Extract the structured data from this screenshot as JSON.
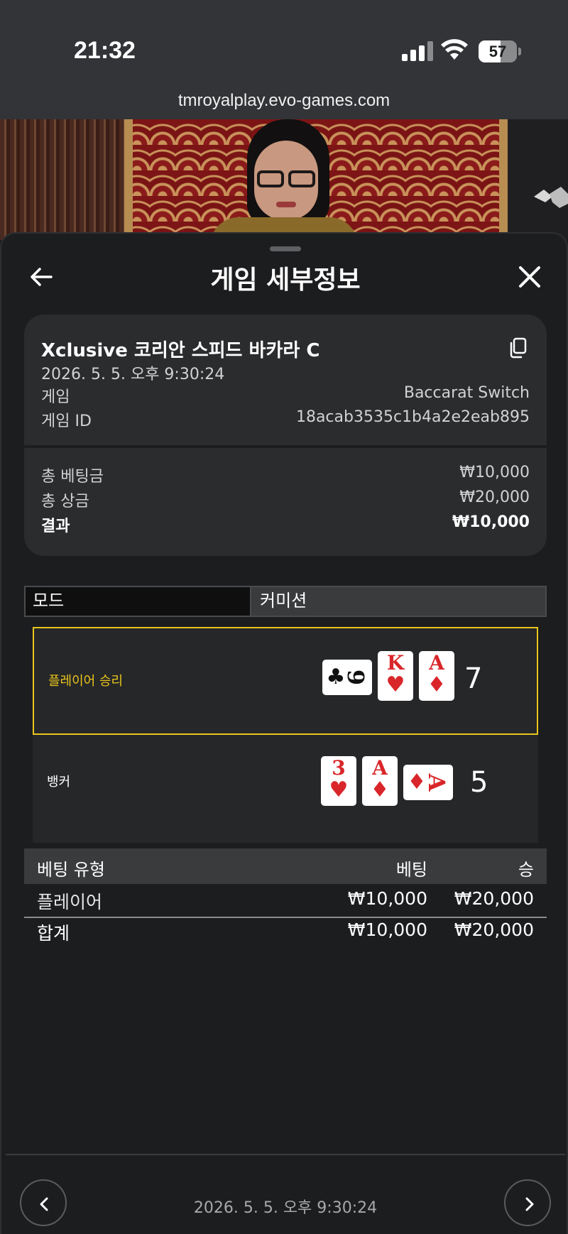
{
  "status_bar": {
    "time": "21:32",
    "battery": "57",
    "battery_level": 0.57
  },
  "browser": {
    "url": "tmroyalplay.evo-games.com"
  },
  "sheet": {
    "title": "게임 세부정보"
  },
  "game_info": {
    "table_name": "Xclusive 코리안 스피드 바카라 C",
    "datetime": "2026. 5. 5. 오후 9:30:24",
    "game_label": "게임",
    "game_value": "Baccarat Switch",
    "game_id_label": "게임 ID",
    "game_id_value": "18acab3535c1b4a2e2eab895"
  },
  "totals": {
    "total_bet_label": "총 베팅금",
    "total_bet_value": "₩10,000",
    "total_win_label": "총 상금",
    "total_win_value": "₩20,000",
    "result_label": "결과",
    "result_value": "₩10,000"
  },
  "mode_table": {
    "mode_label": "모드",
    "commission_label": "커미션"
  },
  "hands": {
    "player": {
      "label": "플레이어 승리",
      "score": "7",
      "label_color": "#e8c51c",
      "cards": [
        {
          "rank": "9",
          "suit": "♣",
          "color": "black",
          "rotated": true
        },
        {
          "rank": "K",
          "suit": "♥",
          "color": "red",
          "rotated": false
        },
        {
          "rank": "A",
          "suit": "♦",
          "color": "red",
          "rotated": false
        }
      ]
    },
    "banker": {
      "label": "뱅커",
      "score": "5",
      "cards": [
        {
          "rank": "3",
          "suit": "♥",
          "color": "red",
          "rotated": false
        },
        {
          "rank": "A",
          "suit": "♦",
          "color": "red",
          "rotated": false
        },
        {
          "rank": "A",
          "suit": "♦",
          "color": "red",
          "rotated": true
        }
      ]
    }
  },
  "bets_table": {
    "headers": {
      "type": "베팅 유형",
      "bet": "베팅",
      "win": "승"
    },
    "rows": [
      {
        "type": "플레이어",
        "bet": "₩10,000",
        "win": "₩20,000"
      }
    ],
    "total": {
      "type": "합계",
      "bet": "₩10,000",
      "win": "₩20,000"
    }
  },
  "footer": {
    "datetime": "2026. 5. 5. 오후 9:30:24"
  },
  "colors": {
    "background": "#1c1d1f",
    "card_bg": "#2b2c2e",
    "winner_accent": "#e8c51c",
    "card_red": "#d9262a"
  }
}
